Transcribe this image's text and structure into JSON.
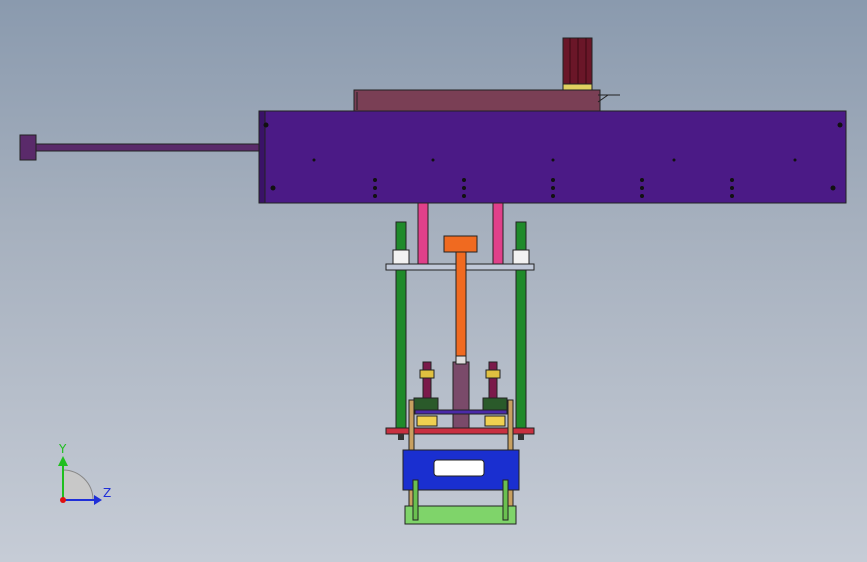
{
  "viewport": {
    "background_top": "#8a9aae",
    "background_bottom": "#c6ccd6"
  },
  "triad": {
    "y_label": "Y",
    "z_label": "Z",
    "y_color": "#1fbf1f",
    "z_color": "#1f2fd8",
    "x_color": "#e01010"
  },
  "colors": {
    "beam": "#4b1a86",
    "motor_housing": "#7a3f55",
    "motor": "#6a1628",
    "rod": "#5a2a6a",
    "pink_rod": "#e0408a",
    "green_column": "#1f8a2a",
    "orange_shaft": "#f06a20",
    "blue_block": "#1a2fd0",
    "green_base": "#7fd46a",
    "tan_bracket": "#c8a060",
    "plate": "#c0c8d8",
    "red_plate": "#c83040"
  }
}
